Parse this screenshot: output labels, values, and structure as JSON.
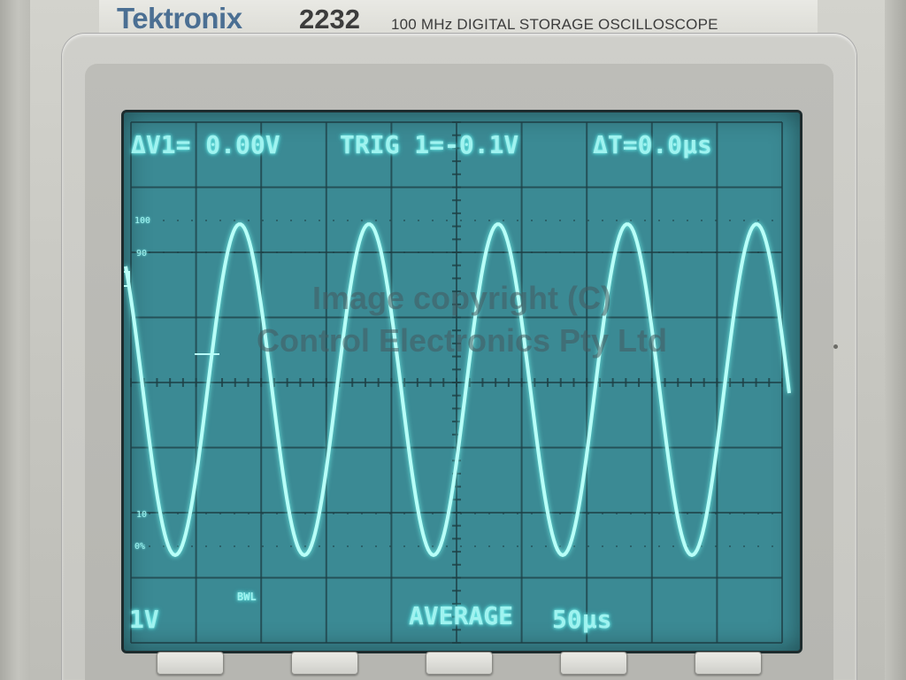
{
  "instrument": {
    "brand": "Tektronix",
    "model": "2232",
    "description": "100 MHz DIGITAL STORAGE OSCILLOSCOPE"
  },
  "screen": {
    "delta_v": "ΔV1= 0.00V",
    "trigger": "TRIG 1=-0.1V",
    "delta_t": "ΔT=0.0µs",
    "volts_per_div": "1V",
    "bandwidth_limit": "BWL",
    "acquisition_mode": "AVERAGE",
    "time_per_div": "50µs",
    "percent_marks": [
      "100",
      "90",
      "10",
      "0%"
    ],
    "watermark": "Image copyright (C)\nControl Electronics Pty Ltd"
  },
  "colors": {
    "screen_bg": "#3b8a94",
    "trace": "#b8fff8",
    "readout": "#9ff3f0",
    "brand": "#4b6f93"
  },
  "softkeys": [
    "",
    "",
    "",
    "",
    ""
  ]
}
